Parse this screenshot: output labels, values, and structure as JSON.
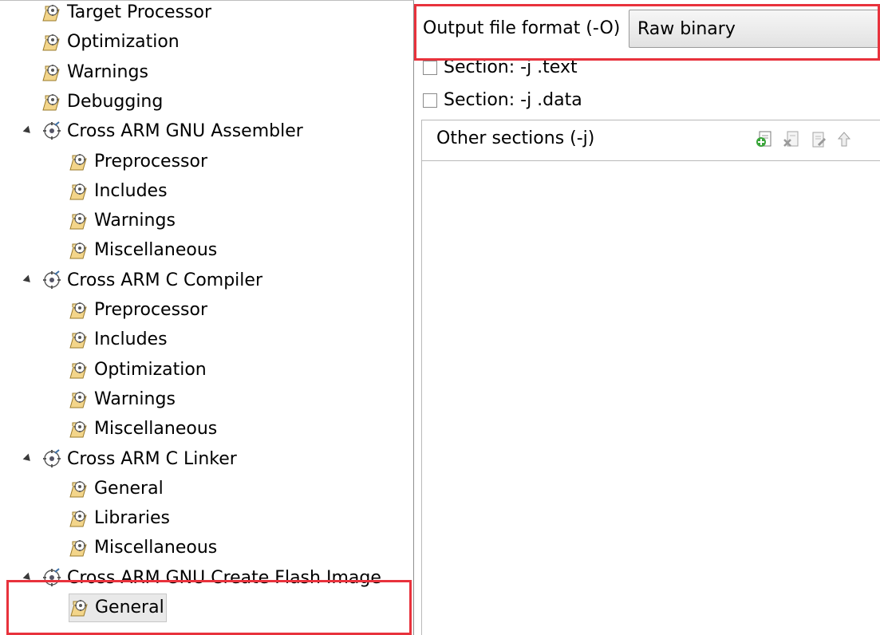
{
  "tree": {
    "items": [
      {
        "label": "Target Processor",
        "level": 2,
        "type": "page"
      },
      {
        "label": "Optimization",
        "level": 2,
        "type": "page"
      },
      {
        "label": "Warnings",
        "level": 2,
        "type": "page"
      },
      {
        "label": "Debugging",
        "level": 2,
        "type": "page"
      },
      {
        "label": "Cross ARM GNU Assembler",
        "level": 1,
        "type": "tool",
        "expanded": true
      },
      {
        "label": "Preprocessor",
        "level": 2,
        "type": "page"
      },
      {
        "label": "Includes",
        "level": 2,
        "type": "page"
      },
      {
        "label": "Warnings",
        "level": 2,
        "type": "page"
      },
      {
        "label": "Miscellaneous",
        "level": 2,
        "type": "page"
      },
      {
        "label": "Cross ARM C Compiler",
        "level": 1,
        "type": "tool",
        "expanded": true
      },
      {
        "label": "Preprocessor",
        "level": 2,
        "type": "page"
      },
      {
        "label": "Includes",
        "level": 2,
        "type": "page"
      },
      {
        "label": "Optimization",
        "level": 2,
        "type": "page"
      },
      {
        "label": "Warnings",
        "level": 2,
        "type": "page"
      },
      {
        "label": "Miscellaneous",
        "level": 2,
        "type": "page"
      },
      {
        "label": "Cross ARM C Linker",
        "level": 1,
        "type": "tool",
        "expanded": true
      },
      {
        "label": "General",
        "level": 2,
        "type": "page"
      },
      {
        "label": "Libraries",
        "level": 2,
        "type": "page"
      },
      {
        "label": "Miscellaneous",
        "level": 2,
        "type": "page"
      },
      {
        "label": "Cross ARM GNU Create Flash Image",
        "level": 1,
        "type": "tool",
        "expanded": true
      },
      {
        "label": "General",
        "level": 2,
        "type": "page",
        "selected": true
      }
    ]
  },
  "settings": {
    "output_format_label": "Output file format (-O)",
    "output_format_value": "Raw binary",
    "section_text_label": "Section: -j .text",
    "section_data_label": "Section: -j .data",
    "other_sections_label": "Other sections (-j)"
  },
  "colors": {
    "highlight": "#e8323c",
    "selection_bg": "#e9e9e9"
  }
}
